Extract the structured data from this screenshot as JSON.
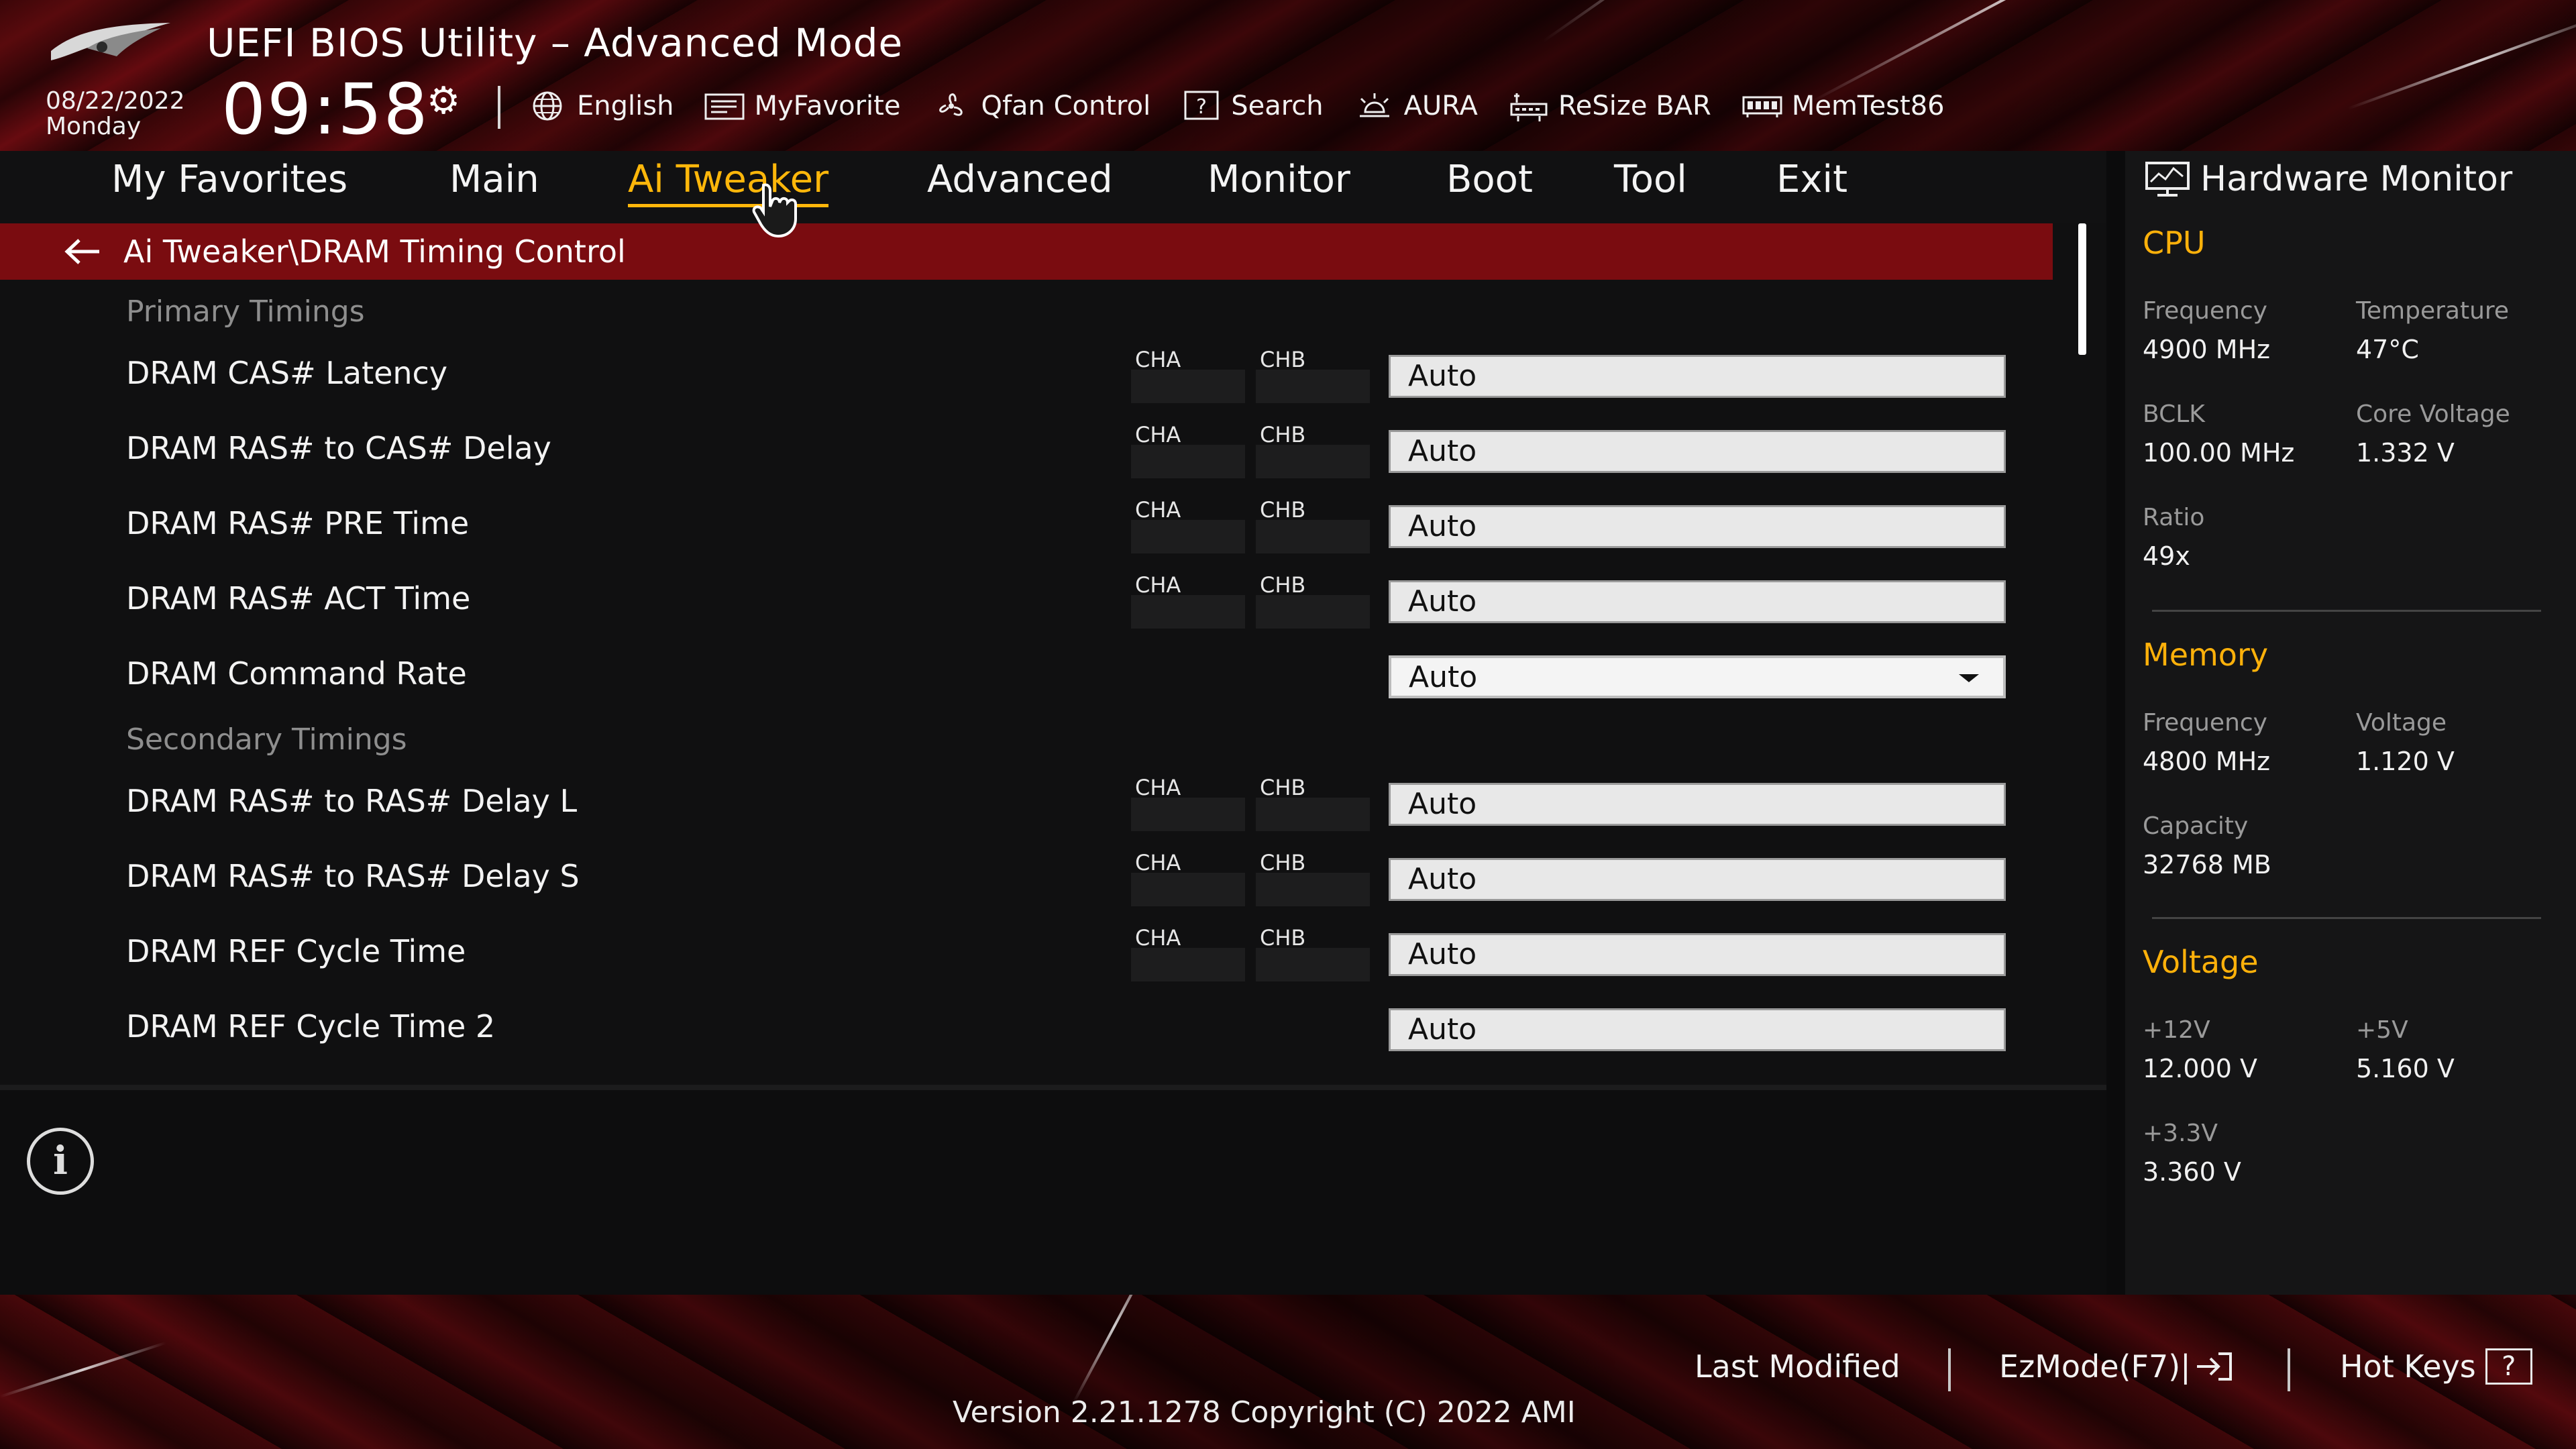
{
  "header": {
    "title": "UEFI BIOS Utility – Advanced Mode",
    "date": "08/22/2022",
    "day": "Monday",
    "time": "09:58",
    "toolbar": [
      {
        "label": "English",
        "icon": "globe-icon"
      },
      {
        "label": "MyFavorite",
        "icon": "favorite-icon"
      },
      {
        "label": "Qfan Control",
        "icon": "fan-icon"
      },
      {
        "label": "Search",
        "icon": "search-help-icon"
      },
      {
        "label": "AURA",
        "icon": "aura-icon"
      },
      {
        "label": "ReSize BAR",
        "icon": "resize-bar-icon"
      },
      {
        "label": "MemTest86",
        "icon": "memory-icon"
      }
    ]
  },
  "nav": {
    "tabs": [
      {
        "label": "My Favorites"
      },
      {
        "label": "Main"
      },
      {
        "label": "Ai Tweaker",
        "active": true
      },
      {
        "label": "Advanced"
      },
      {
        "label": "Monitor"
      },
      {
        "label": "Boot"
      },
      {
        "label": "Tool"
      },
      {
        "label": "Exit"
      }
    ]
  },
  "main": {
    "breadcrumb": "Ai Tweaker\\DRAM Timing Control",
    "channel_a": "CHA",
    "channel_b": "CHB",
    "sections": [
      {
        "label": "Primary Timings"
      },
      {
        "label": "Secondary Timings"
      }
    ],
    "rows": [
      {
        "label": "DRAM CAS# Latency",
        "value": "Auto"
      },
      {
        "label": "DRAM RAS# to CAS# Delay",
        "value": "Auto"
      },
      {
        "label": "DRAM RAS# PRE Time",
        "value": "Auto"
      },
      {
        "label": "DRAM RAS# ACT Time",
        "value": "Auto"
      },
      {
        "label": "DRAM Command Rate",
        "value": "Auto"
      },
      {
        "label": "DRAM RAS# to RAS# Delay L",
        "value": "Auto"
      },
      {
        "label": "DRAM RAS# to RAS# Delay S",
        "value": "Auto"
      },
      {
        "label": "DRAM REF Cycle Time",
        "value": "Auto"
      },
      {
        "label": "DRAM REF Cycle Time 2",
        "value": "Auto"
      }
    ]
  },
  "hw": {
    "title": "Hardware Monitor",
    "cpu": {
      "label": "CPU",
      "frequency_label": "Frequency",
      "frequency": "4900 MHz",
      "temperature_label": "Temperature",
      "temperature": "47°C",
      "bclk_label": "BCLK",
      "bclk": "100.00 MHz",
      "core_voltage_label": "Core Voltage",
      "core_voltage": "1.332 V",
      "ratio_label": "Ratio",
      "ratio": "49x"
    },
    "memory": {
      "label": "Memory",
      "frequency_label": "Frequency",
      "frequency": "4800 MHz",
      "voltage_label": "Voltage",
      "voltage": "1.120 V",
      "capacity_label": "Capacity",
      "capacity": "32768 MB"
    },
    "voltage": {
      "label": "Voltage",
      "v12_label": "+12V",
      "v12": "12.000 V",
      "v5_label": "+5V",
      "v5": "5.160 V",
      "v33_label": "+3.3V",
      "v33": "3.360 V"
    }
  },
  "footer": {
    "last_modified": "Last Modified",
    "ezmode": "EzMode(F7)|",
    "hot_keys": "Hot Keys",
    "hot_keys_glyph": "?",
    "version": "Version 2.21.1278 Copyright (C) 2022 AMI"
  },
  "colors": {
    "accent": "#ffb70a",
    "breadcrumb_bar": "#7a0c10",
    "header_red": "#5a0a0d"
  }
}
